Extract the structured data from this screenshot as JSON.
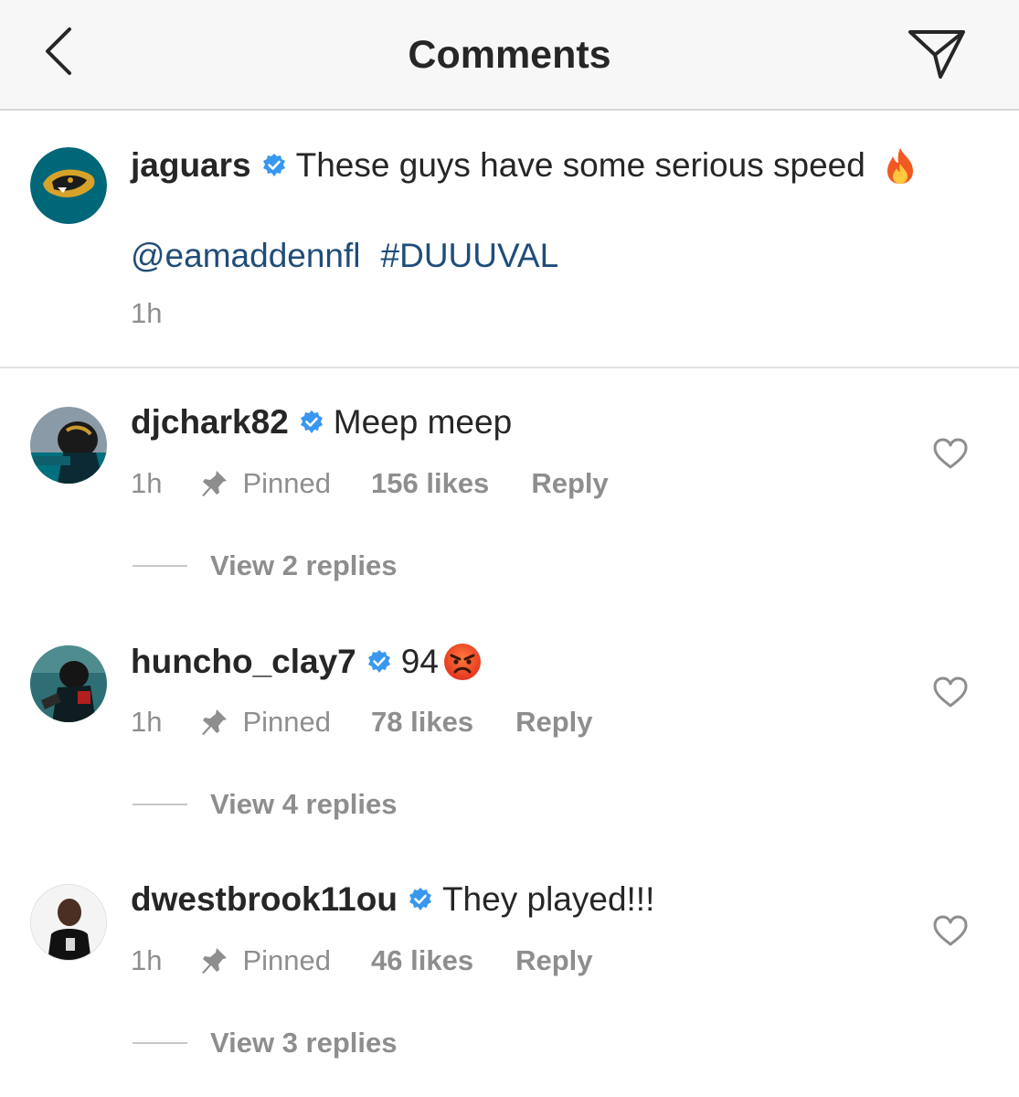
{
  "header": {
    "title": "Comments",
    "back_icon": "chevron-left-icon",
    "send_icon": "paper-plane-icon"
  },
  "caption": {
    "username": "jaguars",
    "text": "These guys have some serious speed",
    "emoji": "fire-emoji",
    "mention": "@eamaddennfl",
    "hashtag": "#DUUUVAL",
    "time": "1h"
  },
  "comments": [
    {
      "username": "djchark82",
      "text": "Meep meep",
      "time": "1h",
      "pinned_label": "Pinned",
      "likes": "156 likes",
      "reply_label": "Reply",
      "view_replies": "View 2 replies"
    },
    {
      "username": "huncho_clay7",
      "text": "94",
      "emoji": "angry-face-emoji",
      "time": "1h",
      "pinned_label": "Pinned",
      "likes": "78 likes",
      "reply_label": "Reply",
      "view_replies": "View 4 replies"
    },
    {
      "username": "dwestbrook11ou",
      "text": "They played!!!",
      "time": "1h",
      "pinned_label": "Pinned",
      "likes": "46 likes",
      "reply_label": "Reply",
      "view_replies": "View 3 replies"
    }
  ],
  "colors": {
    "verified": "#3897f0",
    "link": "#1f4d7a",
    "muted": "#8e8e8e",
    "text": "#262626",
    "jaguars_teal": "#006778"
  }
}
